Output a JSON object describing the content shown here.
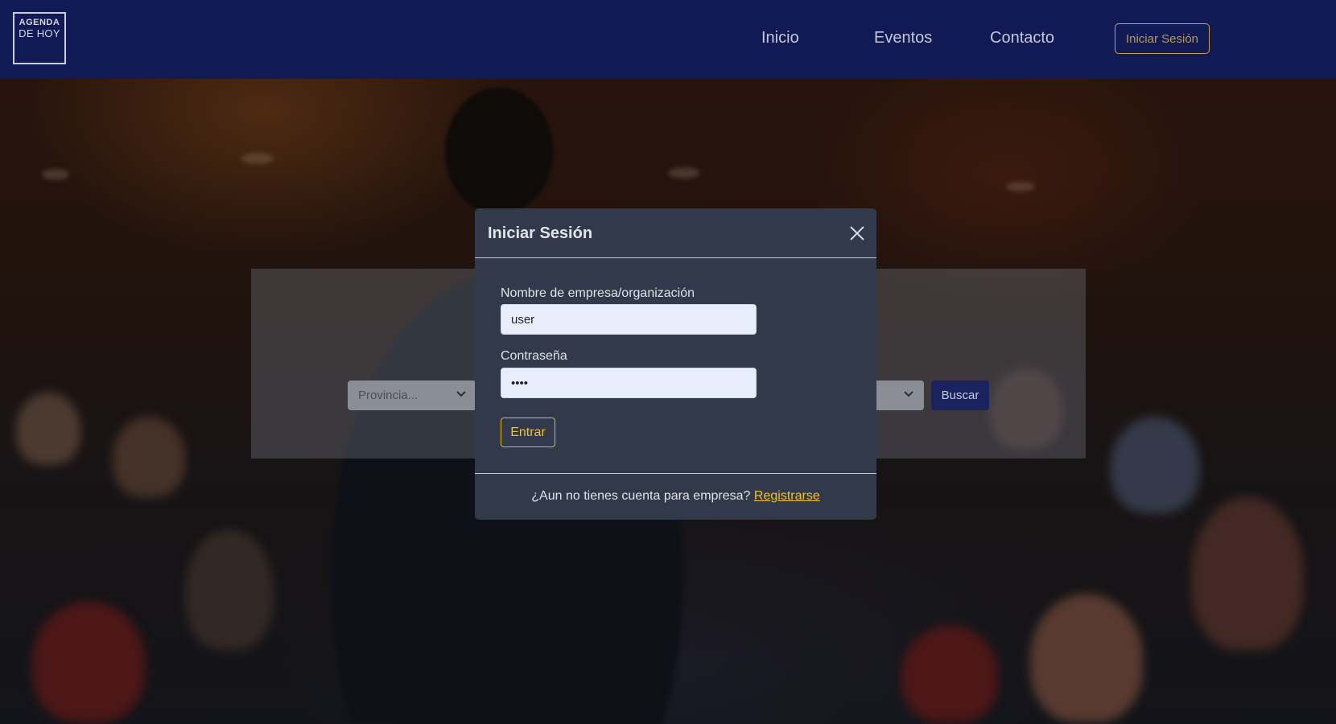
{
  "nav": {
    "logo_line1": "AGENDA",
    "logo_line2": "DE HOY",
    "links": [
      "Inicio",
      "Eventos",
      "Contacto"
    ],
    "login_button": "Iniciar Sesión",
    "background_color": "#121a55",
    "accent_color": "#caa13a"
  },
  "search": {
    "provincia_placeholder": "Provincia...",
    "buscar_label": "Buscar"
  },
  "modal": {
    "title": "Iniciar Sesión",
    "company_label": "Nombre de empresa/organización",
    "company_value": "user",
    "password_label": "Contraseña",
    "password_value": "••••",
    "submit_label": "Entrar",
    "footer_text": "¿Aun no tienes cuenta para empresa?",
    "register_link": "Registrarse",
    "background_color": "#31394a",
    "accent_color": "#f2c12e"
  }
}
